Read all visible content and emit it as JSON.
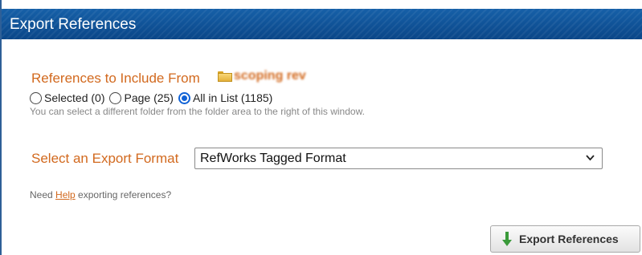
{
  "dialog": {
    "title": "Export References"
  },
  "include": {
    "label": "References to Include From",
    "folder_name": "scoping rev",
    "options": [
      {
        "label": "Selected (0)",
        "checked": false
      },
      {
        "label": "Page (25)",
        "checked": false
      },
      {
        "label": "All in List (1185)",
        "checked": true
      }
    ],
    "hint": "You can select a different folder from the folder area to the right of this window."
  },
  "format": {
    "label": "Select an Export Format",
    "selected": "RefWorks Tagged Format"
  },
  "help": {
    "prefix": "Need ",
    "link": "Help",
    "suffix": " exporting references?"
  },
  "actions": {
    "export_label": "Export References"
  },
  "icons": {
    "folder": "folder-icon",
    "dropdown": "chevron-down-icon",
    "export": "download-arrow-icon"
  },
  "colors": {
    "titlebar": "#0e4f92",
    "accent": "#d2691e",
    "radio_checked": "#1062d6",
    "arrow": "#3a9a3a"
  }
}
